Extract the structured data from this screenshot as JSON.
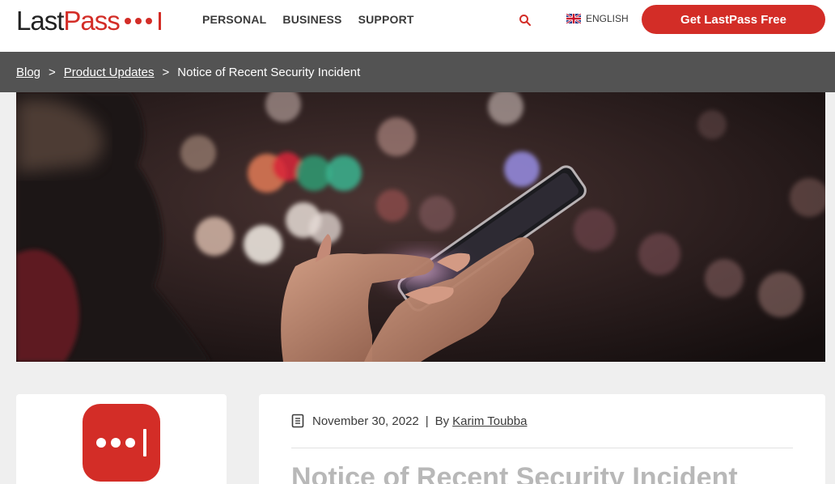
{
  "brand": {
    "logo_black": "Last",
    "logo_red": "Pass",
    "brand_red": "#d32d27"
  },
  "nav": {
    "items": [
      {
        "label": "PERSONAL"
      },
      {
        "label": "BUSINESS"
      },
      {
        "label": "SUPPORT"
      }
    ],
    "search_icon": "search-icon",
    "language_label": "ENGLISH",
    "language_flag": "uk-flag-icon",
    "cta_label": "Get LastPass Free"
  },
  "breadcrumb": {
    "items": [
      {
        "label": "Blog"
      },
      {
        "label": "Product Updates"
      }
    ],
    "separator": ">",
    "current": "Notice of Recent Security Incident"
  },
  "article": {
    "date": "November 30, 2022",
    "separator": "|",
    "by_label": "By",
    "author": "Karim Toubba",
    "title": "Notice of Recent Security Incident"
  },
  "colors": {
    "breadcrumb_bg": "#535353",
    "page_bg": "#efefef"
  }
}
